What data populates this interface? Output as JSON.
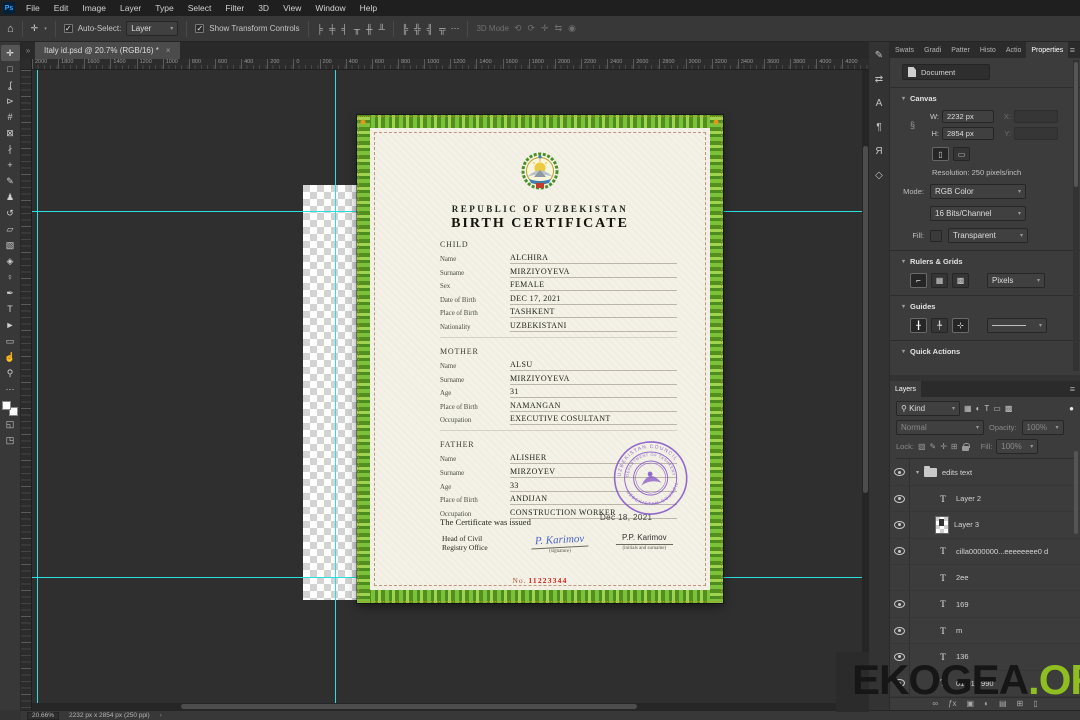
{
  "menu_bar": {
    "logo": "Ps",
    "items": [
      "File",
      "Edit",
      "Image",
      "Layer",
      "Type",
      "Select",
      "Filter",
      "3D",
      "View",
      "Window",
      "Help"
    ]
  },
  "options_bar": {
    "home_icon": "⌂",
    "tool_icon": "✛",
    "auto_select_label": "Auto-Select:",
    "auto_select_value": "Layer",
    "auto_select_check": "✓",
    "show_transform_label": "Show Transform Controls",
    "show_transform_check": "✓",
    "align_icons": [
      "╞",
      "╪",
      "╡",
      "╥",
      "╫",
      "╨"
    ],
    "distribute_icons": [
      "╠",
      "╬",
      "╣",
      "╦"
    ],
    "more_icon": "⋯",
    "mode_3d_label": "3D Mode",
    "mode_3d_icons": [
      "⟲",
      "⟳",
      "✛",
      "⇆",
      "◉"
    ]
  },
  "document_tab": {
    "title": "Italy id.psd @ 20.7% (RGB/16) *",
    "close": "×",
    "collapse": "»"
  },
  "toolbar": {
    "tools": [
      {
        "glyph": "✛",
        "active": true
      },
      {
        "glyph": "□",
        "active": false
      },
      {
        "glyph": "ʆ",
        "active": false
      },
      {
        "glyph": "⊳",
        "active": false
      },
      {
        "glyph": "#",
        "active": false
      },
      {
        "glyph": "⊠",
        "active": false
      },
      {
        "glyph": "∤",
        "active": false
      },
      {
        "glyph": "+",
        "active": false
      },
      {
        "glyph": "✎",
        "active": false
      },
      {
        "glyph": "♟",
        "active": false
      },
      {
        "glyph": "↺",
        "active": false
      },
      {
        "glyph": "▱",
        "active": false
      },
      {
        "glyph": "▧",
        "active": false
      },
      {
        "glyph": "◈",
        "active": false
      },
      {
        "glyph": "♀",
        "active": false
      },
      {
        "glyph": "✒",
        "active": false
      },
      {
        "glyph": "T",
        "active": false
      },
      {
        "glyph": "►",
        "active": false
      },
      {
        "glyph": "▭",
        "active": false
      },
      {
        "glyph": "☝",
        "active": false
      },
      {
        "glyph": "⚲",
        "active": false
      },
      {
        "glyph": "⋯",
        "active": false
      }
    ],
    "mask_mode_icon": "◱",
    "screen_mode_icon": "◳"
  },
  "rulers": {
    "top_labels": [
      "2000",
      "1800",
      "1600",
      "1400",
      "1200",
      "1000",
      "800",
      "600",
      "400",
      "200",
      "0",
      "200",
      "400",
      "600",
      "800",
      "1000",
      "1200",
      "1400",
      "1600",
      "1800",
      "2000",
      "2200",
      "2400",
      "2600",
      "2800",
      "3000",
      "3200",
      "3400",
      "3600",
      "3800",
      "4000",
      "4200"
    ]
  },
  "certificate": {
    "country": "REPUBLIC OF UZBEKISTAN",
    "title": "BIRTH CERTIFICATE",
    "sections": [
      {
        "heading": "CHILD",
        "rows": [
          [
            "Name",
            "ALCHIRA"
          ],
          [
            "Surname",
            "MIRZIYOYEVA"
          ],
          [
            "Sex",
            "FEMALE"
          ],
          [
            "Date of Birth",
            "DEC 17, 2021"
          ],
          [
            "Place of Birth",
            "TASHKENT"
          ],
          [
            "Nationality",
            "UZBEKISTANI"
          ]
        ]
      },
      {
        "heading": "MOTHER",
        "rows": [
          [
            "Name",
            "ALSU"
          ],
          [
            "Surname",
            "MIRZIYOYEVA"
          ],
          [
            "Age",
            "31"
          ],
          [
            "Place of Birth",
            "NAMANGAN"
          ],
          [
            "Occupation",
            "EXECUTIVE COSULTANT"
          ]
        ]
      },
      {
        "heading": "FATHER",
        "rows": [
          [
            "Name",
            "ALISHER"
          ],
          [
            "Surname",
            "MIRZOYEV"
          ],
          [
            "Age",
            "33"
          ],
          [
            "Place of Birth",
            "ANDIJAN"
          ],
          [
            "Occupation",
            "CONSTRUCTION WORKER"
          ]
        ]
      }
    ],
    "issued_label": "The Certificate was issued",
    "issued_date": "Dec 18, 2021",
    "office_label_line1": "Head of Civil",
    "office_label_line2": "Registry Office",
    "signature": "P. Karimov",
    "signature_caption": "(signature)",
    "official_name": "P.P. Karimov",
    "official_caption": "(initials and surname)",
    "number_label": "No.",
    "number_value": "11223344",
    "stamp": {
      "top_text": "UZBEKISTAN COUNCIL",
      "mid_text": "DEPARTMENT OF TASHKENT",
      "bottom_text": "UZBEKISTAN COUNCIL"
    }
  },
  "rail_icons": [
    {
      "glyph": "✎",
      "name": "brush-panel-icon"
    },
    {
      "glyph": "⇄",
      "name": "tool-presets-icon"
    },
    {
      "glyph": "A",
      "name": "character-panel-icon"
    },
    {
      "glyph": "¶",
      "name": "paragraph-panel-icon"
    },
    {
      "glyph": "Я",
      "name": "glyphs-panel-icon"
    },
    {
      "glyph": "◇",
      "name": "3d-panel-icon"
    }
  ],
  "properties_panel": {
    "tabs": [
      {
        "label": "Swats",
        "active": false
      },
      {
        "label": "Gradi",
        "active": false
      },
      {
        "label": "Patter",
        "active": false
      },
      {
        "label": "Histo",
        "active": false
      },
      {
        "label": "Actio",
        "active": false
      },
      {
        "label": "Properties",
        "active": true
      }
    ],
    "menu_icon": "≡",
    "document_type": "Document",
    "canvas_title": "Canvas",
    "w_label": "W:",
    "w_value": "2232 px",
    "h_label": "H:",
    "h_value": "2854 px",
    "x_label": "X:",
    "y_label": "Y:",
    "resolution": "Resolution: 250 pixels/inch",
    "mode_label": "Mode:",
    "mode_value": "RGB Color",
    "depth_value": "16 Bits/Channel",
    "fill_label": "Fill:",
    "fill_value": "Transparent",
    "rulers_grids_title": "Rulers & Grids",
    "rulers_icons": [
      "⌐",
      "▦",
      "▩"
    ],
    "units_value": "Pixels",
    "guides_title": "Guides",
    "guides_icons": [
      "╂",
      "╄",
      "⊹"
    ],
    "quick_actions_title": "Quick Actions"
  },
  "layers_panel": {
    "title": "Layers",
    "menu_icon": "≡",
    "search_icon": "⚲",
    "kind_label": "Kind",
    "filter_icons": [
      "▦",
      "◐",
      "T",
      "▭",
      "▩"
    ],
    "filter_dot": "●",
    "blend_mode": "Normal",
    "opacity_label": "Opacity:",
    "opacity_value": "100%",
    "lock_label": "Lock:",
    "lock_icons": [
      "▨",
      "✎",
      "✛",
      "⊞"
    ],
    "fill_label": "Fill:",
    "fill_value": "100%",
    "layers": [
      {
        "name": "edits text",
        "is_group": true,
        "is_text": false,
        "is_image": false,
        "visible": true,
        "indent": false
      },
      {
        "name": "Layer 2",
        "is_group": false,
        "is_text": true,
        "is_image": false,
        "visible": true,
        "indent": true
      },
      {
        "name": "Layer 3",
        "is_group": false,
        "is_text": false,
        "is_image": true,
        "visible": true,
        "indent": true
      },
      {
        "name": "cilla0000000...eeeeeeee0 d",
        "is_group": false,
        "is_text": true,
        "is_image": false,
        "visible": true,
        "indent": true
      },
      {
        "name": "2ee",
        "is_group": false,
        "is_text": true,
        "is_image": false,
        "visible": false,
        "indent": true
      },
      {
        "name": "169",
        "is_group": false,
        "is_text": true,
        "is_image": false,
        "visible": true,
        "indent": true
      },
      {
        "name": "m",
        "is_group": false,
        "is_text": true,
        "is_image": false,
        "visible": true,
        "indent": true
      },
      {
        "name": "136",
        "is_group": false,
        "is_text": true,
        "is_image": false,
        "visible": true,
        "indent": true
      },
      {
        "name": "01.01.1990",
        "is_group": false,
        "is_text": true,
        "is_image": false,
        "visible": true,
        "indent": true
      }
    ],
    "footer_icons": [
      "∞",
      "ƒx",
      "▣",
      "◐",
      "▤",
      "⊞",
      "▯"
    ]
  },
  "status_bar": {
    "zoom": "20.66%",
    "doc_info": "2232 px x 2854 px (250 ppi)",
    "caret": "›"
  },
  "watermark": {
    "text_dark": "EKOGEA",
    "text_green": ".ORG"
  },
  "colors": {
    "accent_green": "#8fbe21",
    "guide_cyan": "#2be0e0",
    "stamp_purple": "#8456c8",
    "cert_red": "#d21d14",
    "signature_blue": "#4a66c8"
  }
}
